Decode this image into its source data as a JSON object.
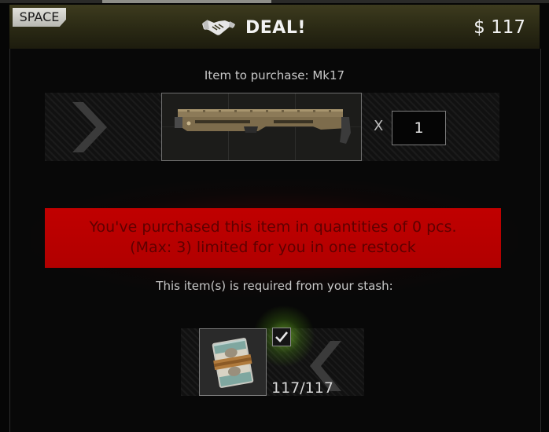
{
  "header": {
    "key_hint": "SPACE",
    "title": "DEAL!",
    "price": "$ 117"
  },
  "purchase": {
    "label": "Item to purchase: Mk17",
    "quantity_symbol": "X",
    "quantity": "1"
  },
  "warning": {
    "line1": "You've purchased this item in quantities of 0 pcs.",
    "line2": "(Max: 3) limited for you in one restock",
    "purchased": 0,
    "max": 3
  },
  "requirements": {
    "label": "This item(s) is required from your stash:",
    "items": [
      {
        "icon": "money-stack-icon",
        "count": "117/117",
        "checked": true
      }
    ]
  },
  "colors": {
    "header_bg": "#2f2d17",
    "warning_bg": "#c00000",
    "warning_text": "#5e0000",
    "check_glow": "#9dff3a"
  }
}
